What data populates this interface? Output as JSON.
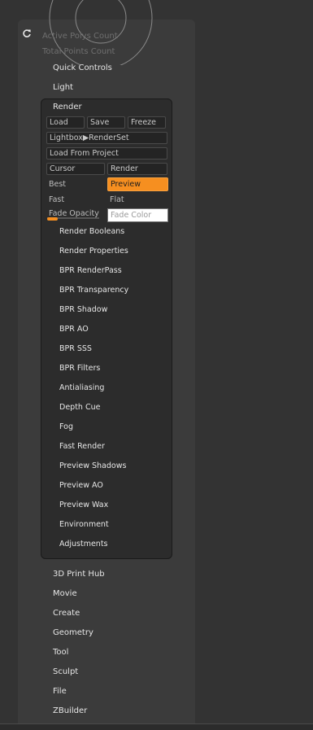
{
  "stats": {
    "active_polys_label": "Active Polys Count",
    "total_points_label": "Total Points Count"
  },
  "top_menu": [
    {
      "label": "Quick Controls"
    },
    {
      "label": "Light"
    }
  ],
  "render": {
    "title": "Render",
    "buttons": {
      "load": "Load",
      "save": "Save",
      "freeze": "Freeze",
      "lightbox": "Lightbox▶RenderSet",
      "load_from_project": "Load From Project",
      "cursor": "Cursor",
      "render": "Render",
      "preview": "Preview"
    },
    "modes": {
      "best": "Best",
      "fast": "Fast",
      "flat": "Flat"
    },
    "fade_opacity_label": "Fade Opacity",
    "fade_opacity_value": 0.2,
    "fade_color_placeholder": "Fade Color",
    "accent_color": "#f68f20",
    "sub_items": [
      "Render Booleans",
      "Render Properties",
      "BPR RenderPass",
      "BPR Transparency",
      "BPR Shadow",
      "BPR AO",
      "BPR SSS",
      "BPR Filters",
      "Antialiasing",
      "Depth Cue",
      "Fog",
      "Fast Render",
      "Preview Shadows",
      "Preview AO",
      "Preview Wax",
      "Environment",
      "Adjustments"
    ]
  },
  "bottom_menu": [
    "3D Print Hub",
    "Movie",
    "Create",
    "Geometry",
    "Tool",
    "Sculpt",
    "File",
    "ZBuilder"
  ],
  "icons": {
    "refresh": "refresh-icon",
    "gizmo": "navigation-gizmo-icon"
  }
}
